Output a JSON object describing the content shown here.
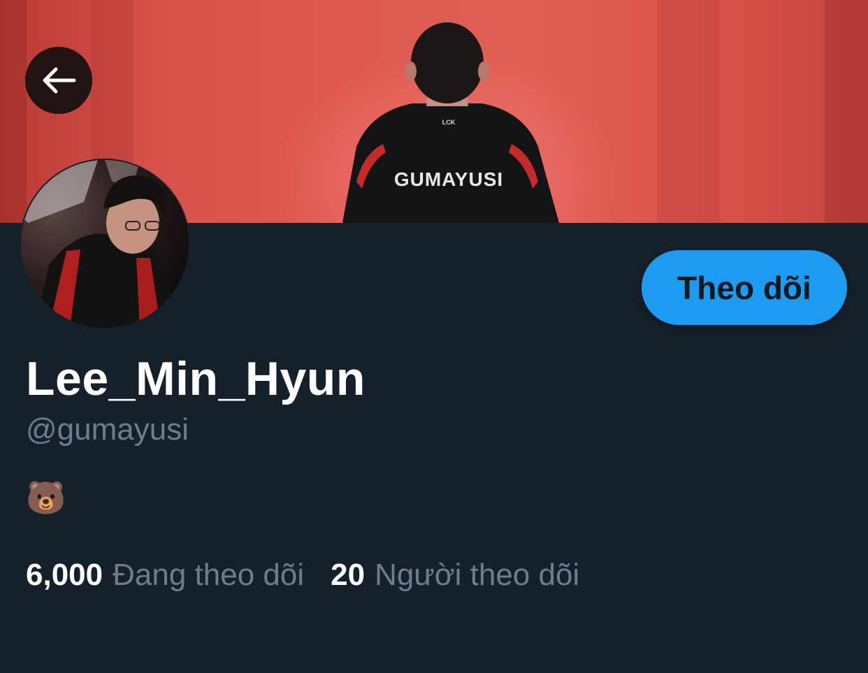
{
  "profile": {
    "display_name": "Lee_Min_Hyun",
    "handle": "@gumayusi",
    "bio": "🐻",
    "banner_jersey_text": "GUMAYUSI",
    "banner_collar_text": "LCK"
  },
  "actions": {
    "follow_label": "Theo dõi"
  },
  "stats": {
    "following_count": "6,000",
    "following_label": "Đang theo dõi",
    "followers_count": "20",
    "followers_label": "Người theo dõi"
  },
  "colors": {
    "background": "#16202b",
    "accent": "#1d9bf0",
    "muted_text": "#6e7d8c",
    "banner_red": "#d65149"
  },
  "icons": {
    "back": "arrow-left-icon"
  }
}
